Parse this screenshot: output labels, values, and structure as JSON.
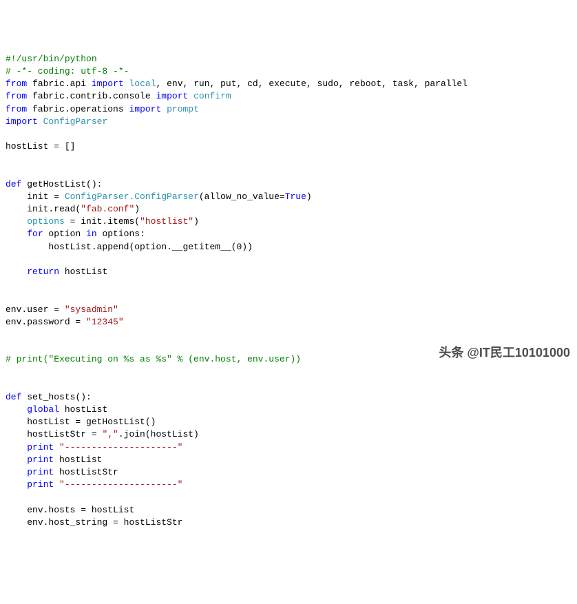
{
  "lines": [
    {
      "type": "comment",
      "text": "#!/usr/bin/python"
    },
    {
      "type": "comment",
      "text": "# -*- coding: utf-8 -*-"
    },
    {
      "type": "import1",
      "from": "from",
      "mod": "fabric.api",
      "imp": "import",
      "items_pre": " ",
      "first": "local",
      "rest": ", env, run, put, cd, execute, sudo, reboot, task, parallel"
    },
    {
      "type": "import1",
      "from": "from",
      "mod": "fabric.contrib.console",
      "imp": "import",
      "items_pre": " ",
      "first": "confirm",
      "rest": ""
    },
    {
      "type": "import1",
      "from": "from",
      "mod": "fabric.operations",
      "imp": "import",
      "items_pre": " ",
      "first": "prompt",
      "rest": ""
    },
    {
      "type": "import2",
      "imp": "import",
      "mod": "ConfigParser"
    },
    {
      "type": "blank",
      "text": ""
    },
    {
      "type": "plain",
      "text": "hostList = []"
    },
    {
      "type": "blank",
      "text": ""
    },
    {
      "type": "blank",
      "text": ""
    },
    {
      "type": "def",
      "kw": "def",
      "name": "getHostList",
      "rest": "():"
    },
    {
      "type": "assign_init",
      "indent": "    ",
      "lhs": "init = ",
      "cls": "ConfigParser.ConfigParser",
      "args": "(allow_no_value=",
      "val": "True",
      "tail": ")"
    },
    {
      "type": "call_str",
      "indent": "    ",
      "pre": "init.read(",
      "str": "\"fab.conf\"",
      "post": ")"
    },
    {
      "type": "assign_call_str",
      "indent": "    ",
      "lhs": "options",
      "eq": " = init.items(",
      "str": "\"hostlist\"",
      "post": ")"
    },
    {
      "type": "for",
      "indent": "    ",
      "kw": "for",
      "var": " option ",
      "kw2": "in",
      "rest": " options:"
    },
    {
      "type": "plain_indent",
      "indent": "        ",
      "text": "hostList.append(option.__getitem__(0))"
    },
    {
      "type": "blank",
      "text": ""
    },
    {
      "type": "return",
      "indent": "    ",
      "kw": "return",
      "rest": " hostList"
    },
    {
      "type": "blank",
      "text": ""
    },
    {
      "type": "blank",
      "text": ""
    },
    {
      "type": "assign_str",
      "lhs": "env.user = ",
      "str": "\"sysadmin\""
    },
    {
      "type": "assign_str",
      "lhs": "env.password = ",
      "str": "\"12345\""
    },
    {
      "type": "blank",
      "text": ""
    },
    {
      "type": "blank",
      "text": ""
    },
    {
      "type": "comment",
      "text": "# print(\"Executing on %s as %s\" % (env.host, env.user))"
    },
    {
      "type": "blank",
      "text": ""
    },
    {
      "type": "blank",
      "text": ""
    },
    {
      "type": "def",
      "kw": "def",
      "name": "set_hosts",
      "rest": "():"
    },
    {
      "type": "global",
      "indent": "    ",
      "kw": "global",
      "rest": " hostList"
    },
    {
      "type": "plain_indent",
      "indent": "    ",
      "text": "hostList = getHostList()"
    },
    {
      "type": "assign_join",
      "indent": "    ",
      "lhs": "hostListStr = ",
      "str": "\",\"",
      "post": ".join(hostList)"
    },
    {
      "type": "print_str",
      "indent": "    ",
      "kw": "print",
      "sp": " ",
      "str": "\"---------------------\""
    },
    {
      "type": "print_var",
      "indent": "    ",
      "kw": "print",
      "rest": " hostList"
    },
    {
      "type": "print_var",
      "indent": "    ",
      "kw": "print",
      "rest": " hostListStr"
    },
    {
      "type": "print_str",
      "indent": "    ",
      "kw": "print",
      "sp": " ",
      "str": "\"---------------------\""
    },
    {
      "type": "blank",
      "text": ""
    },
    {
      "type": "plain_indent",
      "indent": "    ",
      "text": "env.hosts = hostList"
    },
    {
      "type": "plain_indent",
      "indent": "    ",
      "text": "env.host_string = hostListStr"
    }
  ],
  "watermark": "头条 @IT民工10101000"
}
